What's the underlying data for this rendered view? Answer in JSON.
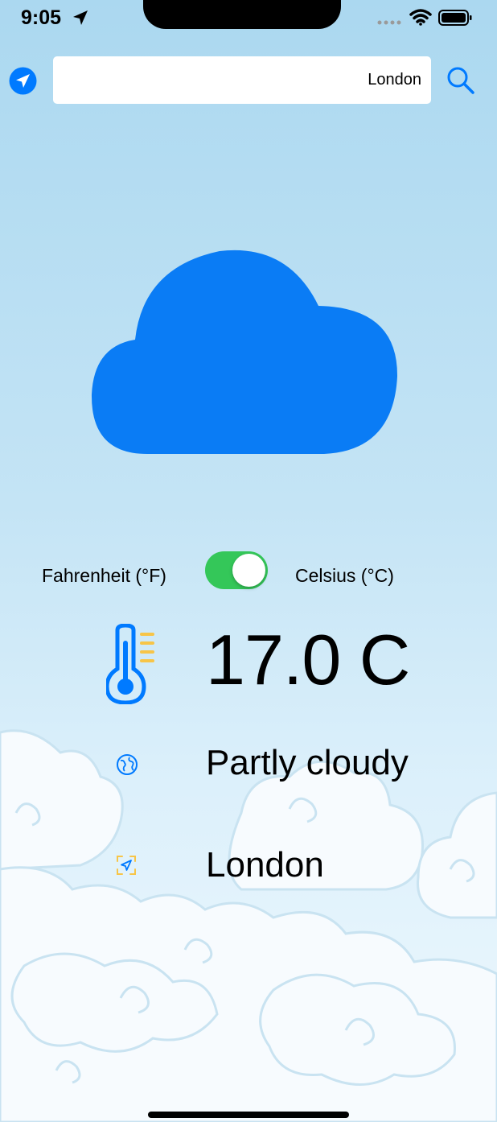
{
  "status_bar": {
    "time": "9:05",
    "icons": [
      "location-arrow-icon",
      "signal-icon",
      "wifi-icon",
      "battery-icon"
    ]
  },
  "search": {
    "value": "London",
    "locate_icon": "location-arrow-icon",
    "search_icon": "search-icon"
  },
  "weather_icon": "cloud-icon",
  "units": {
    "fahrenheit_label": "Fahrenheit (°F)",
    "celsius_label": "Celsius (°C)",
    "celsius_selected": true
  },
  "current": {
    "temperature": "17.0 C",
    "condition": "Partly cloudy",
    "city": "London",
    "temperature_icon": "thermometer-icon",
    "condition_icon": "globe-icon",
    "city_icon": "location-frame-icon"
  },
  "colors": {
    "accent": "#007aff",
    "toggle_on": "#34c759",
    "thermo_lines": "#f7c548"
  }
}
